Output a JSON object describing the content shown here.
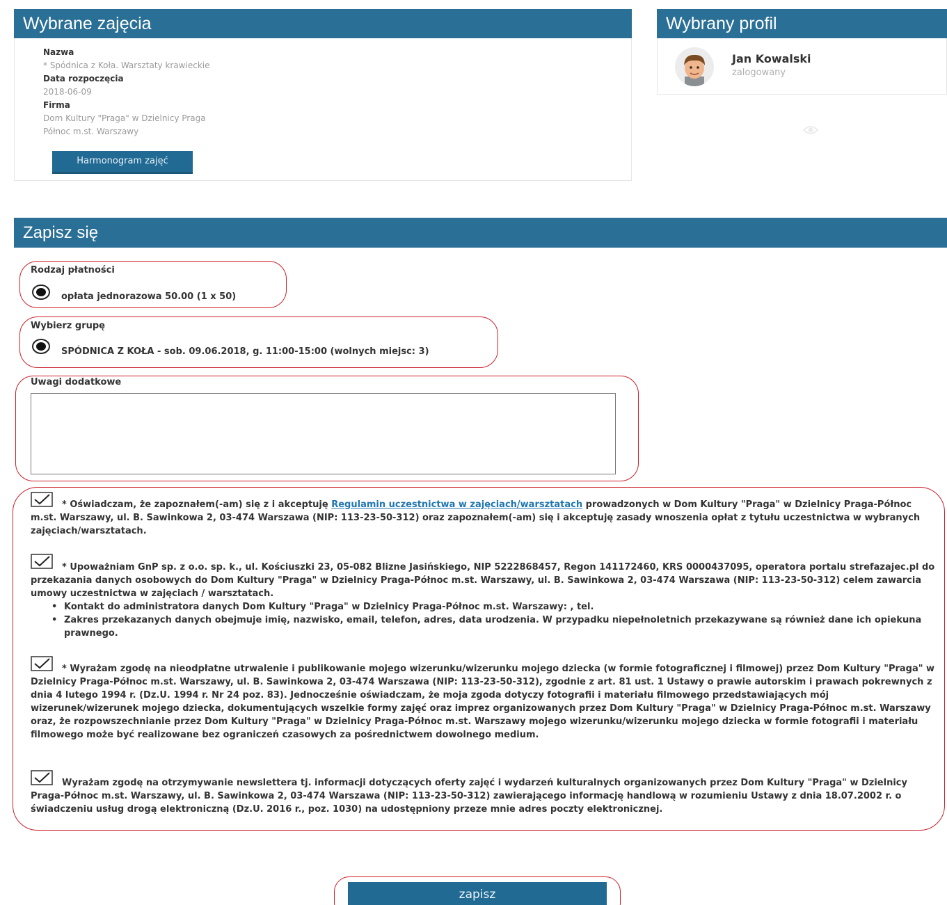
{
  "selected_class": {
    "title": "Wybrane zajęcia",
    "name_label": "Nazwa",
    "name_value": "* Spódnica z Koła. Warsztaty krawieckie",
    "start_label": "Data rozpoczęcia",
    "start_value": "2018-06-09",
    "company_label": "Firma",
    "company_line1": "Dom Kultury \"Praga\" w Dzielnicy Praga",
    "company_line2": "Północ m.st. Warszawy",
    "schedule_button": "Harmonogram zajęć"
  },
  "profile": {
    "title": "Wybrany profil",
    "name": "Jan Kowalski",
    "status": "zalogowany"
  },
  "signup": {
    "title": "Zapisz się",
    "payment_label": "Rodzaj płatności",
    "payment_option": "opłata jednorazowa 50.00 (1 x 50)",
    "group_label": "Wybierz grupę",
    "group_option": "SPÓDNICA Z KOŁA - sob. 09.06.2018, g. 11:00-15:00 (wolnych miejsc: 3)",
    "notes_label": "Uwagi dodatkowe",
    "notes_value": "",
    "consent1_before": "* Oświadczam, że zapoznałem(-am) się z i akceptuję",
    "consent1_link": "Regulamin uczestnictwa w zajęciach/warsztatach",
    "consent1_after": "prowadzonych w Dom Kultury \"Praga\" w Dzielnicy Praga-Północ m.st. Warszawy, ul. B. Sawinkowa 2, 03-474 Warszawa (NIP: 113-23-50-312) oraz zapoznałem(-am) się i akceptuję zasady wnoszenia opłat z tytułu uczestnictwa w wybranych zajęciach/warsztatach.",
    "consent2_text": "* Upoważniam GnP sp. z o.o. sp. k., ul. Kościuszki 23, 05-082 Blizne Jasińskiego, NIP 5222868457, Regon 141172460, KRS 0000437095, operatora portalu strefazajec.pl do przekazania danych osobowych do Dom Kultury \"Praga\" w Dzielnicy Praga-Północ m.st. Warszawy, ul. B. Sawinkowa 2, 03-474 Warszawa (NIP: 113-23-50-312) celem zawarcia umowy uczestnictwa w zajęciach / warsztatach.",
    "consent2_bullet1": "Kontakt do administratora danych Dom Kultury \"Praga\" w Dzielnicy Praga-Północ m.st. Warszawy: , tel.",
    "consent2_bullet2": "Zakres przekazanych danych obejmuje imię, nazwisko, email, telefon, adres, data urodzenia. W przypadku niepełnoletnich przekazywane są również dane ich opiekuna prawnego.",
    "consent3_text": "* Wyrażam zgodę na nieodpłatne utrwalenie i publikowanie mojego wizerunku/wizerunku mojego dziecka (w formie fotograficznej i filmowej) przez Dom Kultury \"Praga\" w Dzielnicy Praga-Północ m.st. Warszawy, ul. B. Sawinkowa 2, 03-474 Warszawa (NIP: 113-23-50-312), zgodnie z art. 81 ust. 1 Ustawy o prawie autorskim i prawach pokrewnych z dnia 4 lutego 1994 r. (Dz.U. 1994 r. Nr 24 poz. 83). Jednocześnie oświadczam, że moja zgoda dotyczy fotografii i materiału filmowego przedstawiających mój wizerunek/wizerunek mojego dziecka, dokumentujących wszelkie formy zajęć oraz imprez organizowanych przez Dom Kultury \"Praga\" w Dzielnicy Praga-Północ m.st. Warszawy oraz, że rozpowszechnianie przez Dom Kultury \"Praga\" w Dzielnicy Praga-Północ m.st. Warszawy mojego wizerunku/wizerunku mojego dziecka w formie fotografii i materiału filmowego może być realizowane bez ograniczeń czasowych za pośrednictwem dowolnego medium.",
    "consent4_text": "Wyrażam zgodę na otrzymywanie newslettera tj. informacji dotyczących oferty zajęć i wydarzeń kulturalnych organizowanych przez Dom Kultury \"Praga\" w Dzielnicy Praga-Północ m.st. Warszawy, ul. B. Sawinkowa 2, 03-474 Warszawa (NIP: 113-23-50-312) zawierającego informację handlową w rozumieniu Ustawy z dnia 18.07.2002 r. o świadczeniu usług drogą elektroniczną (Dz.U. 2016 r., poz. 1030) na udostępniony przeze mnie adres poczty elektronicznej.",
    "submit_label": "zapisz"
  },
  "colors": {
    "header_blue": "#2a6f96",
    "button_blue": "#216a93",
    "annotation_red": "#cc1f2a",
    "link_blue": "#1f76b0"
  }
}
